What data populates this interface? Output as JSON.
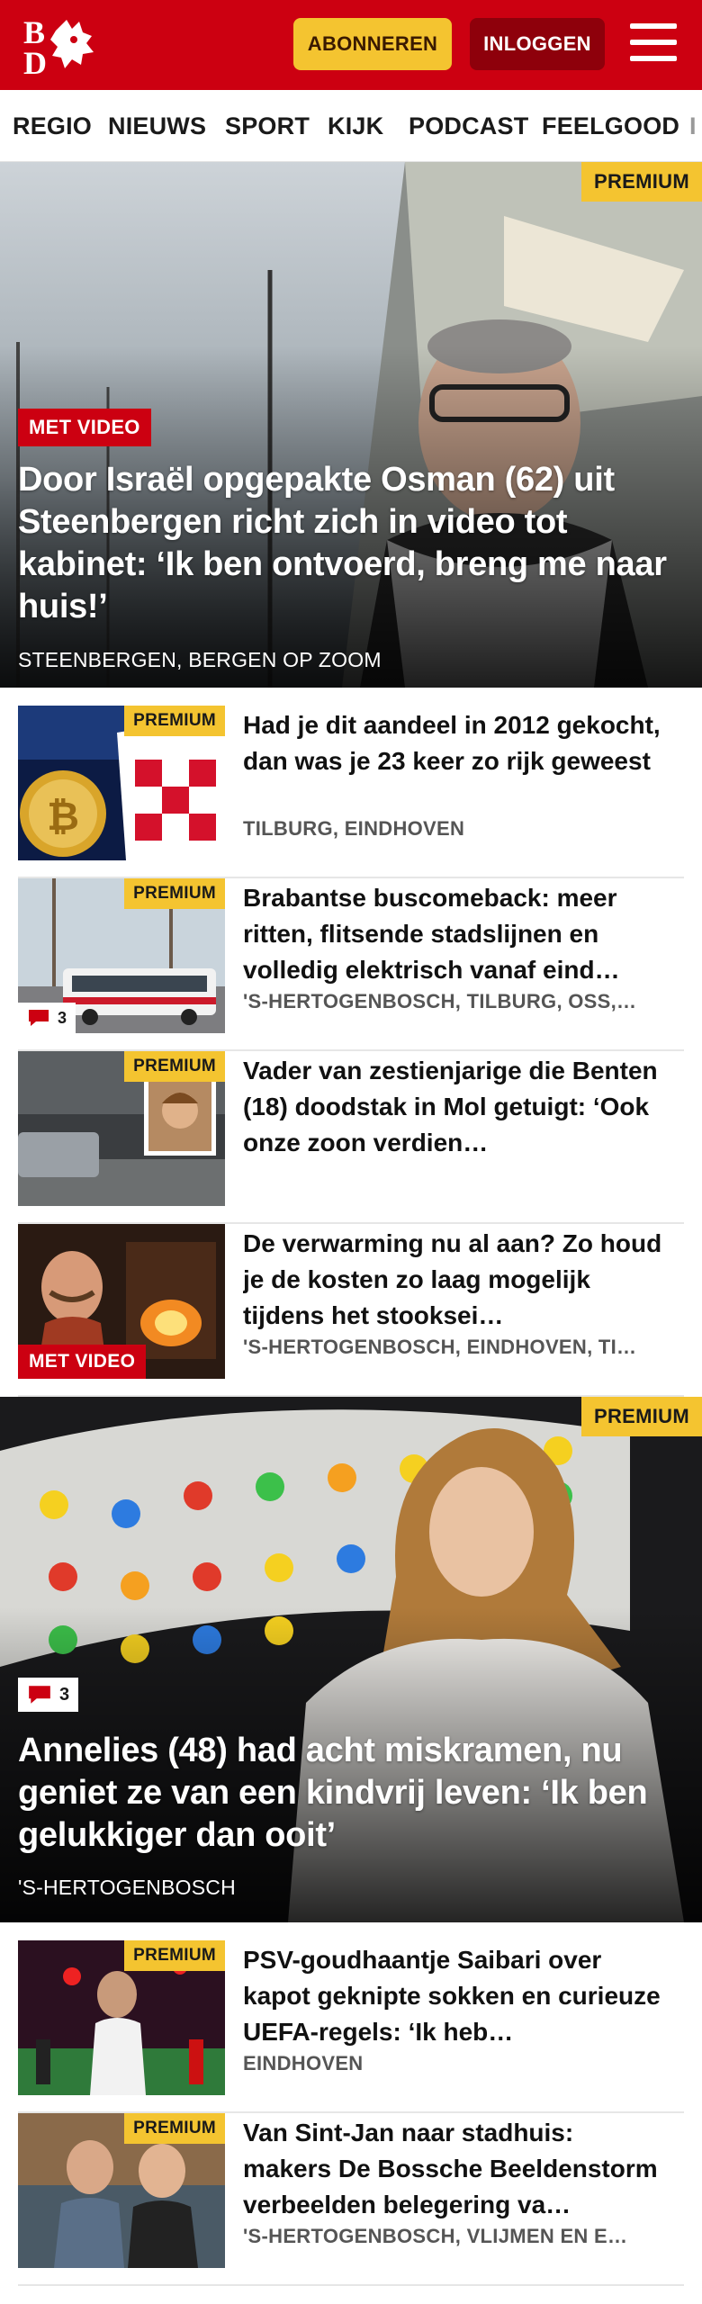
{
  "header": {
    "logo_text": "BD",
    "subscribe_label": "ABONNEREN",
    "login_label": "INLOGGEN"
  },
  "nav": {
    "items": [
      {
        "label": "REGIO"
      },
      {
        "label": "NIEUWS"
      },
      {
        "label": "SPORT"
      },
      {
        "label": "KIJK"
      },
      {
        "label": "PODCAST"
      },
      {
        "label": "FEELGOOD"
      },
      {
        "label": "I"
      }
    ]
  },
  "hero1": {
    "premium": "PREMIUM",
    "badge": "MET VIDEO",
    "title": "Door Israël opgepakte Osman (62) uit Steenbergen richt zich in video tot kabinet: ‘Ik ben ontvoerd, breng me naar huis!’",
    "location": "STEENBERGEN, BERGEN OP ZOOM"
  },
  "articles": [
    {
      "premium": "PREMIUM",
      "title": "Had je dit aandeel in 2012 gekocht, dan was je 23 keer zo rijk geweest",
      "location": "TILBURG, EINDHOVEN"
    },
    {
      "premium": "PREMIUM",
      "comments": "3",
      "title": "Brabantse buscomeback: meer ritten, flitsende stadslijnen en volledig elektrisch vanaf eind…",
      "location": "'S-HERTOGENBOSCH, TILBURG, OSS,…"
    },
    {
      "premium": "PREMIUM",
      "title": "Vader van zestienjarige die Benten (18) doodstak in Mol getuigt: ‘Ook onze zoon verdien…",
      "location": ""
    },
    {
      "badge": "MET VIDEO",
      "title": "De verwarming nu al aan? Zo houd je de kosten zo laag mogelijk tijdens het stooksei­…",
      "location": "'S-HERTOGENBOSCH, EINDHOVEN, TI…"
    }
  ],
  "hero2": {
    "premium": "PREMIUM",
    "comments": "3",
    "title": "Annelies (48) had acht miskramen, nu geniet ze van een kindvrij leven: ‘Ik ben gelukkiger dan ooit’",
    "location": "'S-HERTOGENBOSCH"
  },
  "articles2": [
    {
      "premium": "PREMIUM",
      "title": "PSV-goudhaantje Saibari over kapot geknipte sokken en curieuze UEFA-regels: ‘Ik heb…",
      "location": "EINDHOVEN"
    },
    {
      "premium": "PREMIUM",
      "title": "Van Sint-Jan naar stadhuis: makers De Bossche Beelden­storm verbeelden belegering va…",
      "location": "'S-HERTOGENBOSCH, VLIJMEN EN E…"
    }
  ],
  "colors": {
    "brand_red": "#cc0011",
    "premium_yellow": "#f4c430",
    "login_dark_red": "#8e000b"
  }
}
